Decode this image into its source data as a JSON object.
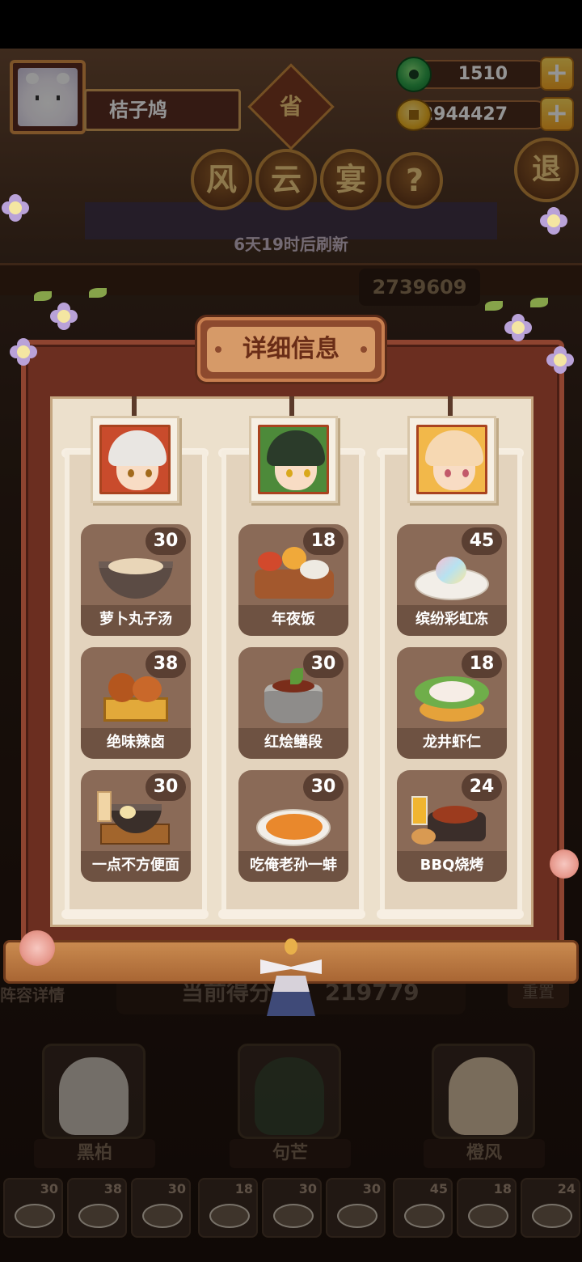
{
  "player": {
    "name": "桔子鸠",
    "avatar": "white-cat-avatar"
  },
  "resources": {
    "jade": "1510",
    "coins": "2944427"
  },
  "header": {
    "badge": "省",
    "title_chars": [
      "风",
      "云",
      "宴"
    ],
    "help": "?",
    "exit": "退",
    "refresh_text": "6天19时后刷新",
    "score_partial": "2739609"
  },
  "modal": {
    "title": "详细信息",
    "columns": [
      {
        "character": "黑柏",
        "portrait_colors": {
          "bg": "#c94b2c",
          "hair": "#e9e6e2"
        },
        "dishes": [
          {
            "name": "萝卜丸子汤",
            "count": "30",
            "icon": "radish-meatball-soup"
          },
          {
            "name": "绝味辣卤",
            "count": "38",
            "icon": "spicy-braised-wings"
          },
          {
            "name": "一点不方便面",
            "count": "30",
            "icon": "instant-noodle-tray"
          }
        ]
      },
      {
        "character": "句芒",
        "portrait_colors": {
          "bg": "#4d8a3a",
          "hair": "#2b3b2a"
        },
        "dishes": [
          {
            "name": "年夜饭",
            "count": "18",
            "icon": "new-year-feast"
          },
          {
            "name": "红烩鳝段",
            "count": "30",
            "icon": "braised-eel-pot"
          },
          {
            "name": "吃俺老孙一蚌",
            "count": "30",
            "icon": "clam-plate"
          }
        ]
      },
      {
        "character": "橙风",
        "portrait_colors": {
          "bg": "#f2b84a",
          "hair": "#f6d8b2"
        },
        "dishes": [
          {
            "name": "缤纷彩虹冻",
            "count": "45",
            "icon": "rainbow-jelly"
          },
          {
            "name": "龙井虾仁",
            "count": "18",
            "icon": "longjing-shrimp"
          },
          {
            "name": "BBQ烧烤",
            "count": "24",
            "icon": "bbq-platter"
          }
        ]
      }
    ]
  },
  "background": {
    "team_label": "阵容详情",
    "current_score_label": "当前得分",
    "current_score": "219779",
    "reset": "重置",
    "characters": [
      "黑柏",
      "句芒",
      "橙风"
    ],
    "mini_dishes": [
      "30",
      "38",
      "30",
      "18",
      "30",
      "30",
      "45",
      "18",
      "24"
    ]
  },
  "colors": {
    "accent": "#d99247",
    "panel": "#6b2e20",
    "paper": "#ece0cc",
    "dish_card": "#8a6a57"
  }
}
